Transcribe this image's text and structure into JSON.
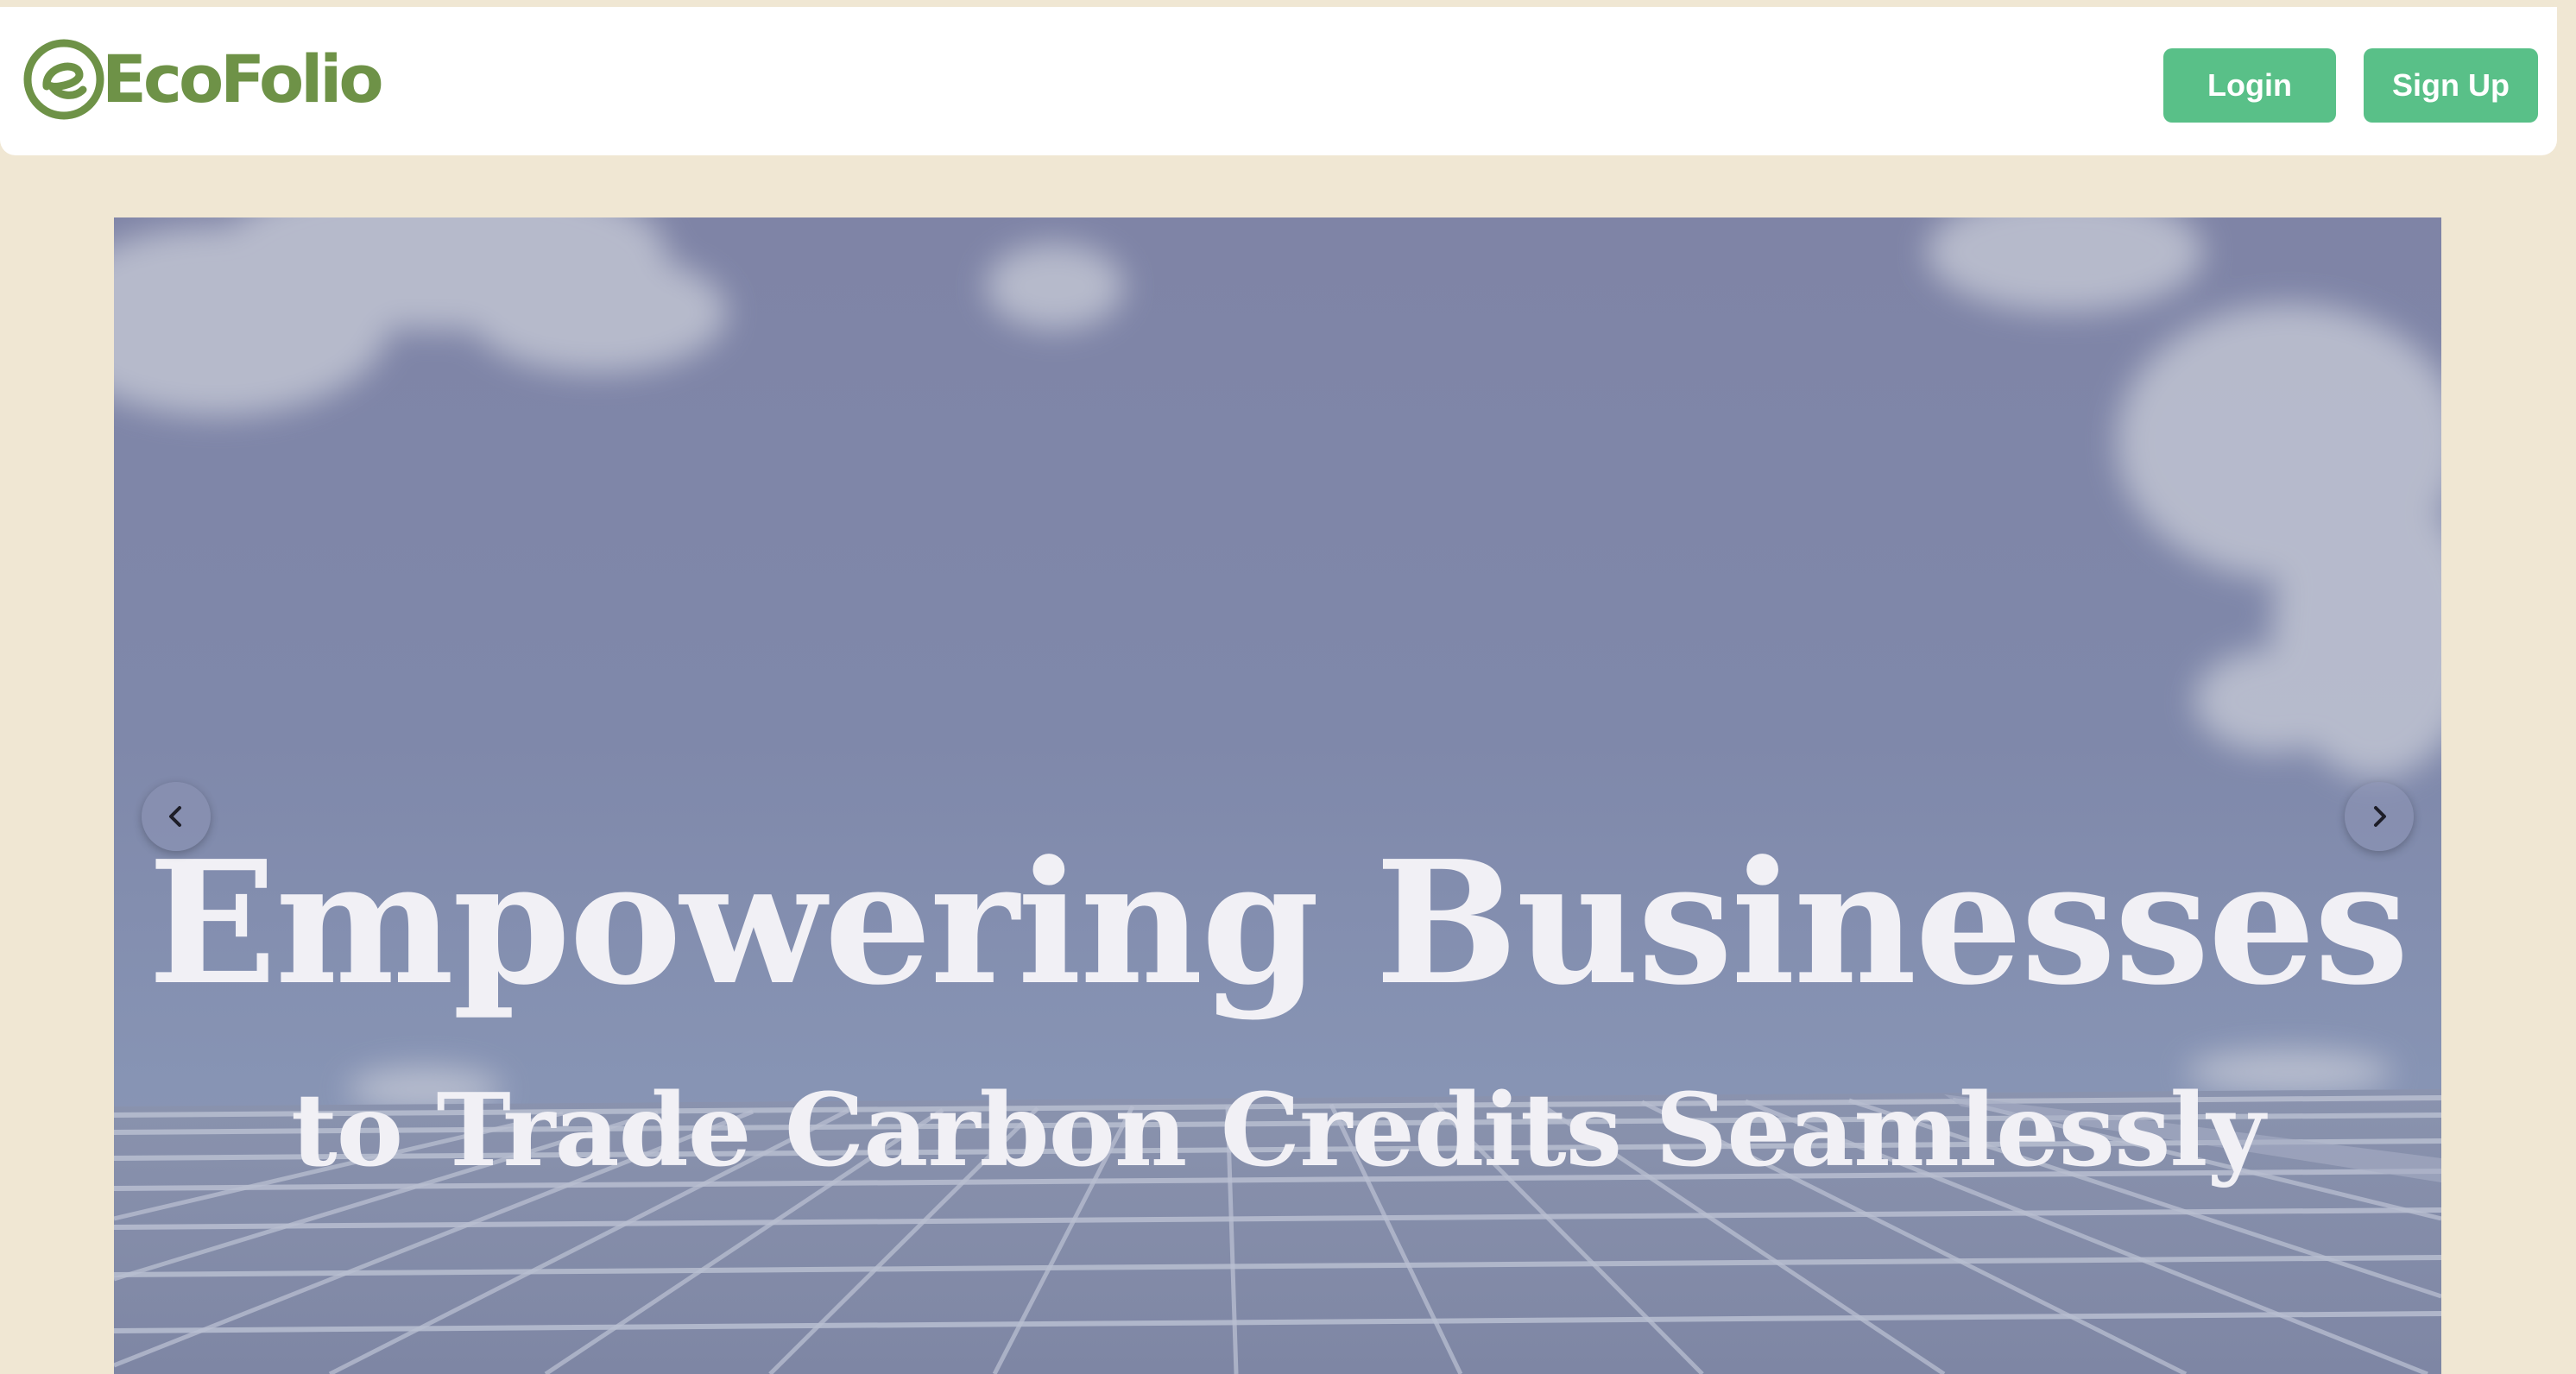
{
  "header": {
    "logo_text": "EcoFolio",
    "login_label": "Login",
    "signup_label": "Sign Up"
  },
  "hero": {
    "title": "Empowering Businesses",
    "subtitle": "to Trade Carbon Credits Seamlessly",
    "prev_icon": "chevron-left-icon",
    "next_icon": "chevron-right-icon"
  },
  "colors": {
    "page_background": "#F0E7D3",
    "brand_green": "#6E9247",
    "button_green": "#59C088",
    "hero_text": "#F1F0F5"
  }
}
